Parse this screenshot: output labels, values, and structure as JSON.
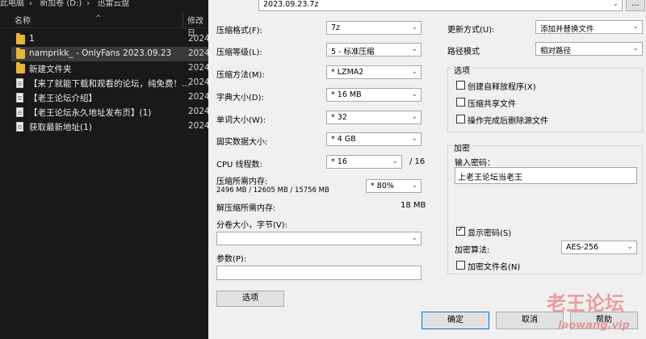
{
  "explorer": {
    "breadcrumb": [
      "此电脑",
      "新加卷 (D:)",
      "迅雷云盘"
    ],
    "col_name": "名称",
    "col_date": "修改日",
    "files": [
      {
        "name": "1",
        "date": "2024",
        "type": "folder",
        "selected": false
      },
      {
        "name": "namprikk_ - OnlyFans 2023.09.23",
        "date": "2024",
        "type": "folder",
        "selected": true
      },
      {
        "name": "新建文件夹",
        "date": "2024",
        "type": "folder",
        "selected": false
      },
      {
        "name": "【来了就能下载和观看的论坛，纯免费！...",
        "date": "2024",
        "type": "doc",
        "selected": false
      },
      {
        "name": "【老王论坛介绍】",
        "date": "2024",
        "type": "doc",
        "selected": false
      },
      {
        "name": "【老王论坛永久地址发布页】(1)",
        "date": "2024",
        "type": "doc",
        "selected": false
      },
      {
        "name": "获取最新地址(1)",
        "date": "2024",
        "type": "doc",
        "selected": false
      }
    ]
  },
  "dialog": {
    "archive_name": "2023.09.23.7z",
    "browse_label": "...",
    "format": {
      "label": "压缩格式(F):",
      "value": "7z"
    },
    "level": {
      "label": "压缩等级(L):",
      "value": "5 - 标准压缩"
    },
    "method": {
      "label": "压缩方法(M):",
      "value": "* LZMA2"
    },
    "dict": {
      "label": "字典大小(D):",
      "value": "* 16 MB"
    },
    "word": {
      "label": "单词大小(W):",
      "value": "* 32"
    },
    "solid": {
      "label": "固实数据大小:",
      "value": "* 4 GB"
    },
    "threads": {
      "label": "CPU 线程数:",
      "value": "* 16",
      "max": "/ 16"
    },
    "mem_compress": {
      "label": "压缩所需内存:",
      "detail": "2496 MB / 12605 MB / 15756 MB",
      "value": "* 80%"
    },
    "mem_decompress": {
      "label": "解压缩所需内存:",
      "value": "18 MB"
    },
    "split": {
      "label": "分卷大小，字节(V):",
      "value": ""
    },
    "params": {
      "label": "参数(P):",
      "value": ""
    },
    "options_button": "选项",
    "update_mode": {
      "label": "更新方式(U):",
      "value": "添加并替换文件"
    },
    "path_mode": {
      "label": "路径模式",
      "value": "相对路径"
    },
    "options_group": {
      "title": "选项",
      "items": [
        {
          "label": "创建自释放程序(X)",
          "checked": false
        },
        {
          "label": "压缩共享文件",
          "checked": false
        },
        {
          "label": "操作完成后删除源文件",
          "checked": false
        }
      ]
    },
    "encryption": {
      "title": "加密",
      "password_label": "输入密码：",
      "password_value": "上老王论坛当老王",
      "show_password": {
        "label": "显示密码(S)",
        "checked": true
      },
      "algorithm_label": "加密算法:",
      "algorithm_value": "AES-256",
      "encrypt_names": {
        "label": "加密文件名(N)",
        "checked": false
      }
    },
    "ok_button": "确定",
    "cancel_button": "取消",
    "help_button": "帮助"
  },
  "watermark": {
    "line1": "老王论坛",
    "line2": "laowang.vip",
    "color": "#e85b5b"
  }
}
